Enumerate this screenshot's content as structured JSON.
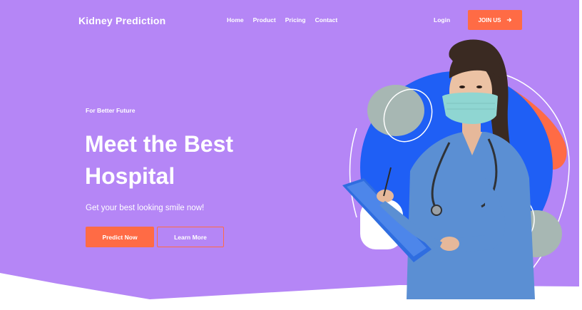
{
  "brand": {
    "name": "Kidney Prediction"
  },
  "nav": {
    "items": [
      "Home",
      "Product",
      "Pricing",
      "Contact"
    ],
    "login": "Login",
    "join": "JOIN US",
    "join_icon": "arrow-right-icon"
  },
  "hero": {
    "tagline": "For Better Future",
    "headline_line1": "Meet the Best",
    "headline_line2": "Hospital",
    "subhead": "Get your best looking smile now!",
    "primary_button": "Predict Now",
    "secondary_button": "Learn More"
  },
  "colors": {
    "hero_bg": "#b586f6",
    "accent": "#ff6b45",
    "blue_circle": "#1f5ff5",
    "gray_blob": "#a7b7b3",
    "scrubs": "#5b8fd3"
  }
}
